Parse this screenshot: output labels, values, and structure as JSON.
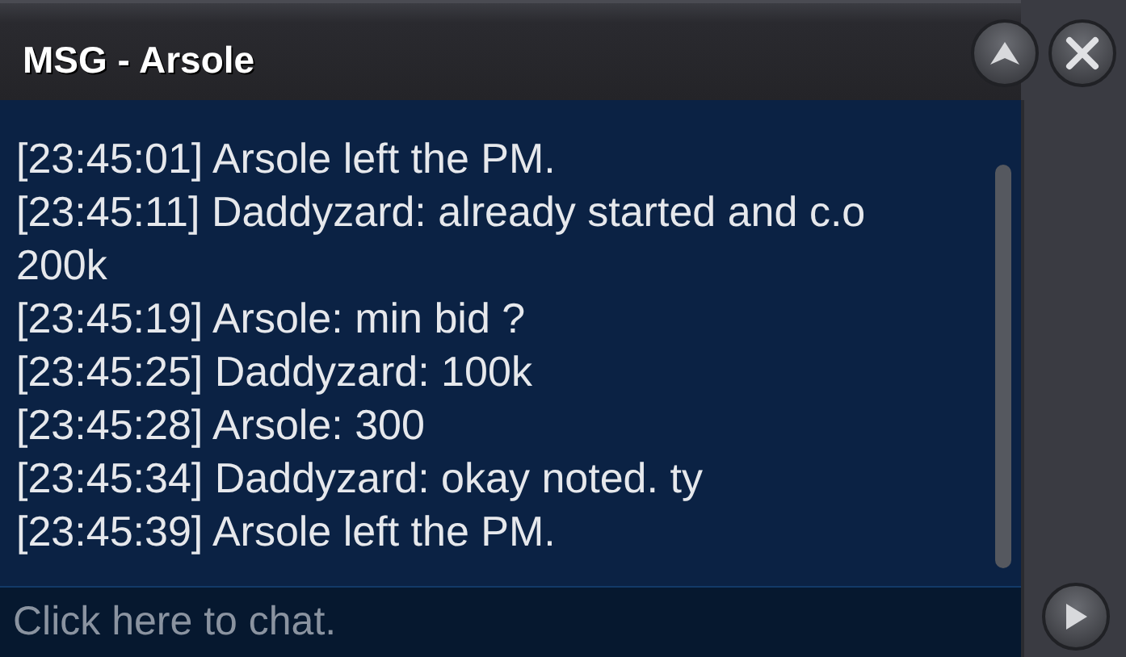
{
  "window": {
    "title": "MSG - Arsole"
  },
  "messages": [
    {
      "text": "[23:45:01] Arsole left the PM."
    },
    {
      "text": "[23:45:11] Daddyzard: already started and c.o 200k"
    },
    {
      "text": "[23:45:19] Arsole: min bid ?"
    },
    {
      "text": "[23:45:25] Daddyzard: 100k"
    },
    {
      "text": "[23:45:28] Arsole: 300"
    },
    {
      "text": "[23:45:34] Daddyzard: okay noted. ty"
    },
    {
      "text": "[23:45:39] Arsole left the PM."
    }
  ],
  "chat_input": {
    "placeholder": "Click here to chat."
  }
}
